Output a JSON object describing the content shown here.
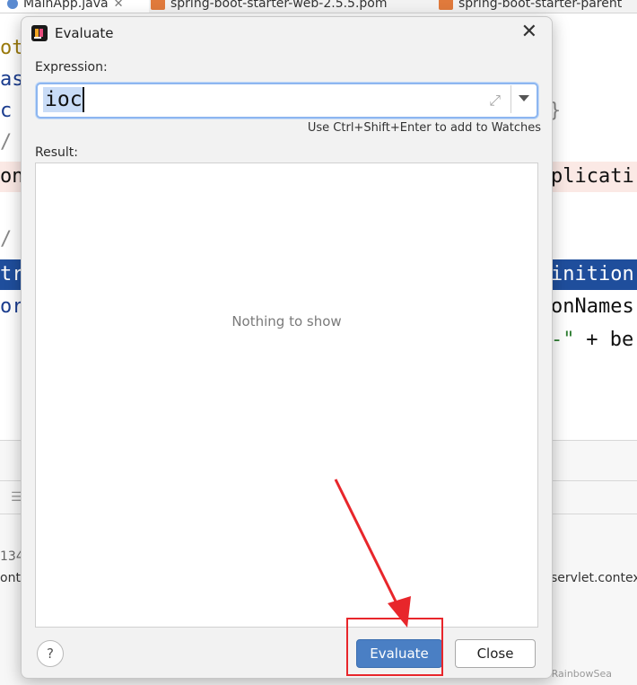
{
  "ide": {
    "tabs": [
      {
        "label": "MainApp.java",
        "active": true
      },
      {
        "label": "spring-boot-starter-web-2.5.5.pom",
        "active": false
      },
      {
        "label": "spring-boot-starter-parent",
        "active": false
      }
    ],
    "code_fragments": {
      "l1": "ot",
      "l2": "as",
      "l3": "c",
      "l3_right": "}",
      "l4": "/",
      "l5_left": "on",
      "l5_right": "plicati",
      "l6": "/",
      "l7_left": "tr",
      "l7_right": "inition",
      "l8_left": "or",
      "l8_right": "onNames",
      "l9_right_str": "-\"",
      "l9_right_rest": " + be"
    },
    "bottom": {
      "num": "134",
      "left_text": "ont",
      "right_text": "servlet.contex"
    },
    "watermark": "CSDN @ChinaRainbowSea"
  },
  "dialog": {
    "title": "Evaluate",
    "close_label": "✕",
    "expression_label": "Expression:",
    "expression_value": "ioc",
    "expand_icon": "⤢",
    "hint": "Use Ctrl+Shift+Enter to add to Watches",
    "result_label": "Result:",
    "empty_text": "Nothing to show",
    "help_label": "?",
    "evaluate_button": "Evaluate",
    "close_button": "Close"
  },
  "colors": {
    "accent": "#4a7fc4",
    "annotation": "#e8262b",
    "selection": "#1f4e9c"
  }
}
